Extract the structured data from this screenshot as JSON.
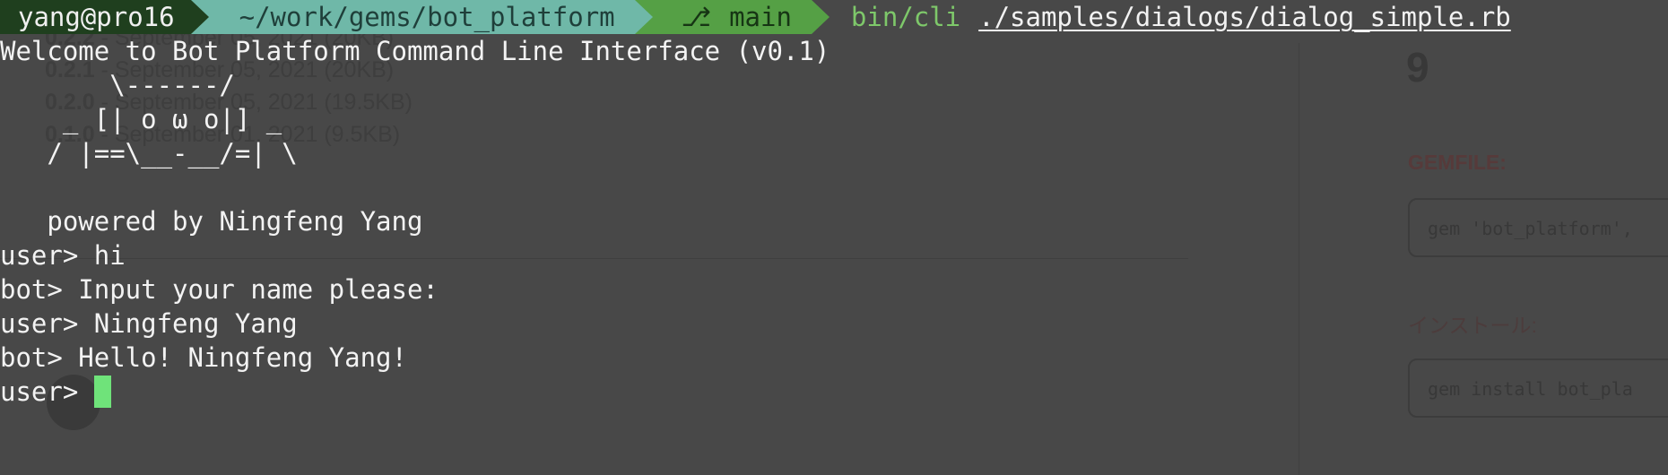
{
  "background_page": {
    "versions": [
      {
        "version": "0.2.2",
        "desc": " - September 05, 2021 (20KB)"
      },
      {
        "version": "0.2.1",
        "desc": " - September 05, 2021 (20KB)"
      },
      {
        "version": "0.2.0",
        "desc": " - September 05, 2021 (19.5KB)"
      },
      {
        "version": "0.1.0",
        "desc": " - September 01, 2021 (9.5KB)"
      }
    ],
    "sidebar_count": "9",
    "gemfile_label": "GEMFILE:",
    "gemfile_code": "gem 'bot_platform',",
    "install_label": "インストール:",
    "install_code": "gem install bot_pla"
  },
  "prompt": {
    "user_host": "yang@pro16",
    "path": "~/work/gems/bot_platform",
    "branch_icon": "git-branch-icon",
    "branch_glyph": "⎇",
    "branch": "main",
    "command": "bin/cli",
    "argument": "./samples/dialogs/dialog_simple.rb"
  },
  "terminal": {
    "lines": [
      "Welcome to Bot Platform Command Line Interface (v0.1)",
      "       \\------/",
      "    _ [| o ω o|] _",
      "   / |==\\__-__/=| \\",
      "",
      "   powered by Ningfeng Yang",
      "user> hi",
      "bot> Input your name please:",
      "user> Ningfeng Yang",
      "bot> Hello! Ningfeng Yang!"
    ],
    "input_prompt": "user> "
  },
  "colors": {
    "background": "#484848",
    "segment_user": "#1f3f1e",
    "segment_path": "#6fb8a8",
    "segment_branch": "#55a045",
    "command": "#7ec86a",
    "cursor": "#6fe37a"
  }
}
